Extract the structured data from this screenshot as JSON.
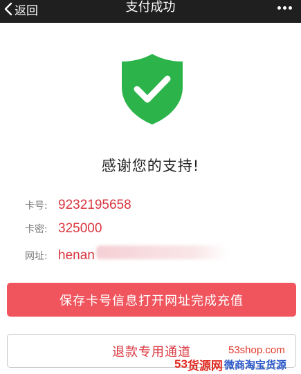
{
  "navbar": {
    "back_label": "返回",
    "title": "支付成功"
  },
  "status": {
    "icon": "shield-check-icon",
    "icon_color": "#2cb34a",
    "message": "感谢您的支持!"
  },
  "card_info": {
    "card_number_label": "卡号:",
    "card_number_value": "9232195658",
    "card_password_label": "卡密:",
    "card_password_value": "325000",
    "url_label": "网址:",
    "url_value": "henan"
  },
  "actions": {
    "primary_label": "保存卡号信息打开网址完成充值",
    "primary_color": "#f0545d",
    "secondary_label": "退款专用通道"
  },
  "watermark": {
    "domain": "53shop.com",
    "brand_num": "53",
    "brand_name": "货源网",
    "brand_sub": "微商淘宝货源"
  }
}
